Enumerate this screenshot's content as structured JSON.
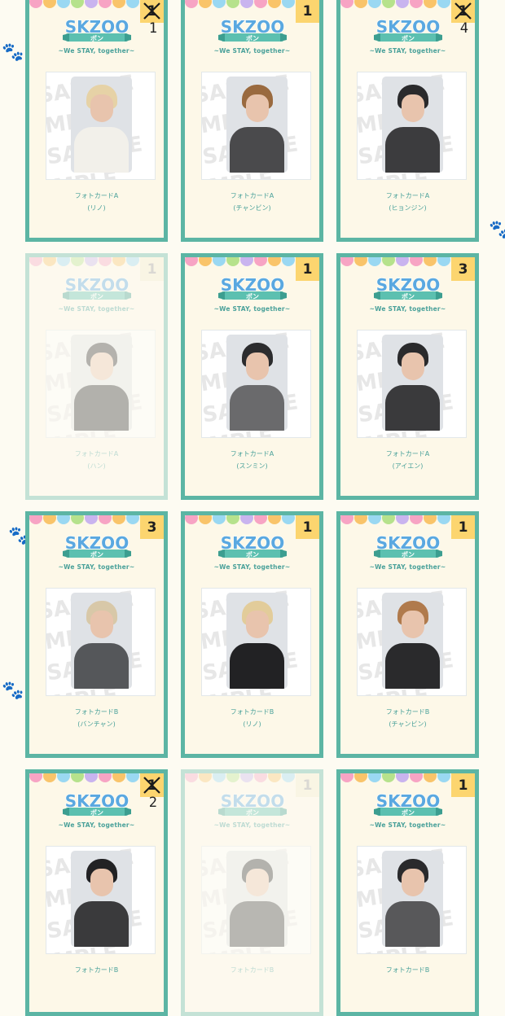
{
  "app": {
    "tagline": "~We STAY, together~",
    "logo_text": "SKZOO",
    "logo_sub": "ポン",
    "watermark": "SAMPLE"
  },
  "colors": {
    "card_border": "#5cb5a4",
    "card_bg": "#fdf8e8",
    "badge_bg": "#fcd56f",
    "caption": "#4aa19a",
    "scallop": [
      "#f7a4c4",
      "#f9c46a",
      "#9ad8f2",
      "#b6e28c",
      "#c9b4ef",
      "#f7a4c4",
      "#f9c46a",
      "#9ad8f2",
      "#b6e28c",
      "#c9b4ef",
      "#f7a4c4"
    ]
  },
  "cards": [
    {
      "type": "フォトカードA",
      "member": "(リノ)",
      "count": "1",
      "crossed": true,
      "faded": false,
      "hand_note": "1",
      "hair": "#e6d2a6",
      "outfit": "#f2f0ea"
    },
    {
      "type": "フォトカードA",
      "member": "(チャンビン)",
      "count": "1",
      "crossed": false,
      "faded": false,
      "hand_note": "",
      "hair": "#9a6a3f",
      "outfit": "#4a4a4c"
    },
    {
      "type": "フォトカードA",
      "member": "(ヒョンジン)",
      "count": "1",
      "crossed": true,
      "faded": false,
      "hand_note": "4",
      "hair": "#2a2a2c",
      "outfit": "#3c3c3e"
    },
    {
      "type": "フォトカードA",
      "member": "(ハン)",
      "count": "1",
      "crossed": false,
      "faded": true,
      "hand_note": "",
      "hair": "#2e2e30",
      "outfit": "#2a2a2c"
    },
    {
      "type": "フォトカードA",
      "member": "(スンミン)",
      "count": "1",
      "crossed": false,
      "faded": false,
      "hand_note": "",
      "hair": "#2c2c2e",
      "outfit": "#6a6a6c"
    },
    {
      "type": "フォトカードA",
      "member": "(アイエン)",
      "count": "3",
      "crossed": false,
      "faded": false,
      "hand_note": "",
      "hair": "#2a2a2c",
      "outfit": "#3a3a3c"
    },
    {
      "type": "フォトカードB",
      "member": "(バンチャン)",
      "count": "3",
      "crossed": false,
      "faded": false,
      "hand_note": "",
      "hair": "#d8c8a8",
      "outfit": "#55575a"
    },
    {
      "type": "フォトカードB",
      "member": "(リノ)",
      "count": "1",
      "crossed": false,
      "faded": false,
      "hand_note": "",
      "hair": "#e2cc9a",
      "outfit": "#222224"
    },
    {
      "type": "フォトカードB",
      "member": "(チャンビン)",
      "count": "1",
      "crossed": false,
      "faded": false,
      "hand_note": "",
      "hair": "#b07a4c",
      "outfit": "#2a2a2c"
    },
    {
      "type": "フォトカードB",
      "member": "",
      "count": "1",
      "crossed": true,
      "faded": false,
      "hand_note": "2",
      "hair": "#222224",
      "outfit": "#3a3a3c"
    },
    {
      "type": "フォトカードB",
      "member": "",
      "count": "1",
      "crossed": false,
      "faded": true,
      "hand_note": "",
      "hair": "#2c2c2e",
      "outfit": "#3a3a3c"
    },
    {
      "type": "フォトカードB",
      "member": "",
      "count": "1",
      "crossed": false,
      "faded": false,
      "hand_note": "",
      "hair": "#2a2a2c",
      "outfit": "#58585a"
    }
  ]
}
